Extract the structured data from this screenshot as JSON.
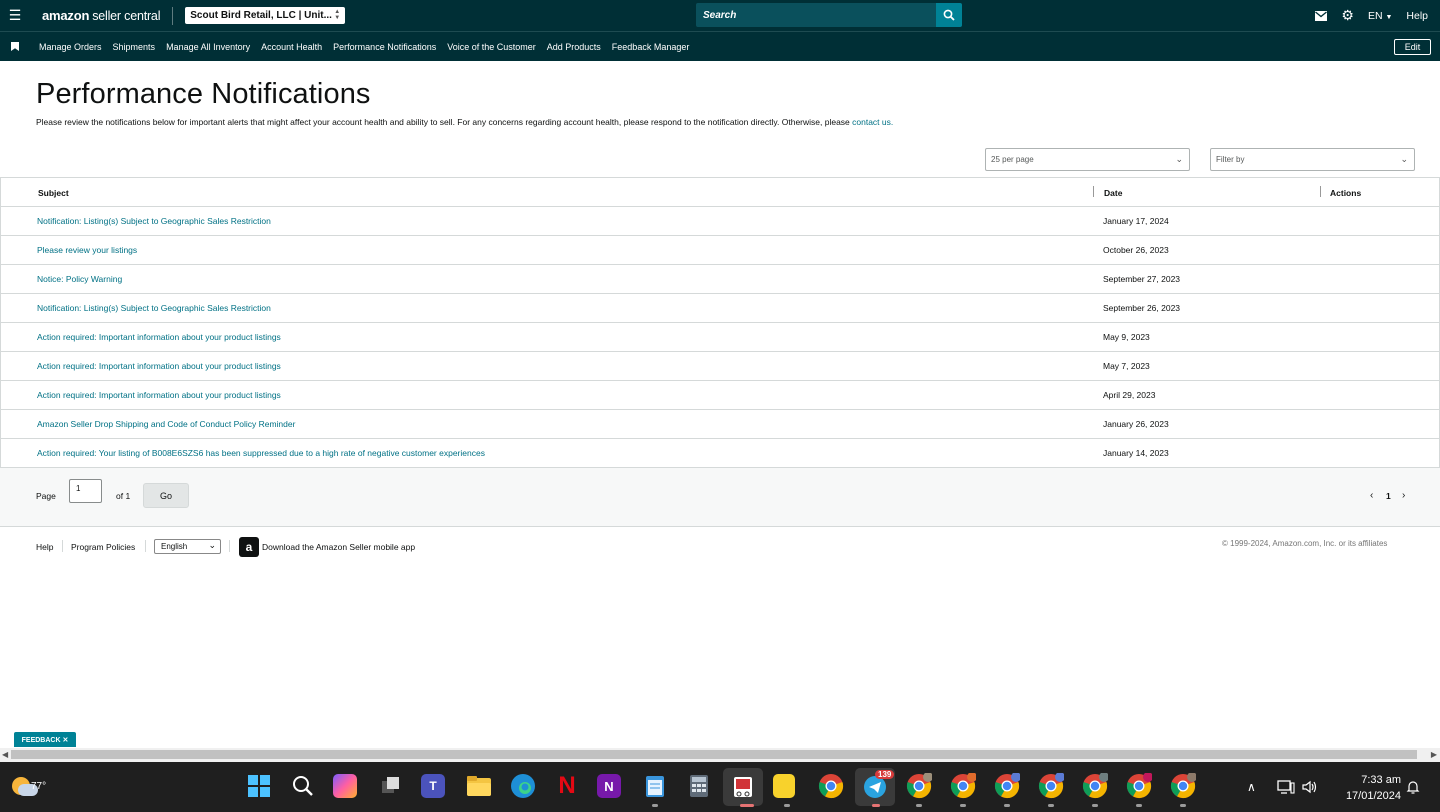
{
  "header": {
    "brand_amazon": "amazon",
    "brand_suffix": "seller central",
    "account": "Scout Bird Retail, LLC | Unit...",
    "search_placeholder": "Search",
    "language": "EN",
    "help": "Help"
  },
  "nav": {
    "items": [
      "Manage Orders",
      "Shipments",
      "Manage All Inventory",
      "Account Health",
      "Performance Notifications",
      "Voice of the Customer",
      "Add Products",
      "Feedback Manager"
    ],
    "edit": "Edit"
  },
  "page": {
    "title": "Performance Notifications",
    "description": "Please review the notifications below for important alerts that might affect your account health and ability to sell. For any concerns regarding account health, please respond to the notification directly. Otherwise, please ",
    "contact_link": "contact us.",
    "per_page": "25 per page",
    "filter_placeholder": "Filter by"
  },
  "table": {
    "headers": {
      "subject": "Subject",
      "date": "Date",
      "actions": "Actions"
    },
    "rows": [
      {
        "subject": "Notification: Listing(s) Subject to Geographic Sales Restriction",
        "date": "January 17, 2024"
      },
      {
        "subject": "Please review your listings",
        "date": "October 26, 2023"
      },
      {
        "subject": "Notice: Policy Warning",
        "date": "September 27, 2023"
      },
      {
        "subject": "Notification: Listing(s) Subject to Geographic Sales Restriction",
        "date": "September 26, 2023"
      },
      {
        "subject": "Action required: Important information about your product listings",
        "date": "May 9, 2023"
      },
      {
        "subject": "Action required: Important information about your product listings",
        "date": "May 7, 2023"
      },
      {
        "subject": "Action required: Important information about your product listings",
        "date": "April 29, 2023"
      },
      {
        "subject": "Amazon Seller Drop Shipping and Code of Conduct Policy Reminder",
        "date": "January 26, 2023"
      },
      {
        "subject": "Action required: Your listing of B008E6SZS6 has been suppressed due to a high rate of negative customer experiences",
        "date": "January 14, 2023"
      }
    ]
  },
  "pager": {
    "page_label": "Page",
    "page_value": "1",
    "of_label": "of 1",
    "go": "Go",
    "current": "1"
  },
  "footer": {
    "help": "Help",
    "program_policies": "Program Policies",
    "language": "English",
    "download": "Download the Amazon Seller mobile app",
    "copyright": "© 1999-2024, Amazon.com, Inc. or its affiliates"
  },
  "feedback": "FEEDBACK ✕",
  "taskbar": {
    "temperature": "77°",
    "telegram_badge": "139",
    "time": "7:33 am",
    "date": "17/01/2024"
  }
}
